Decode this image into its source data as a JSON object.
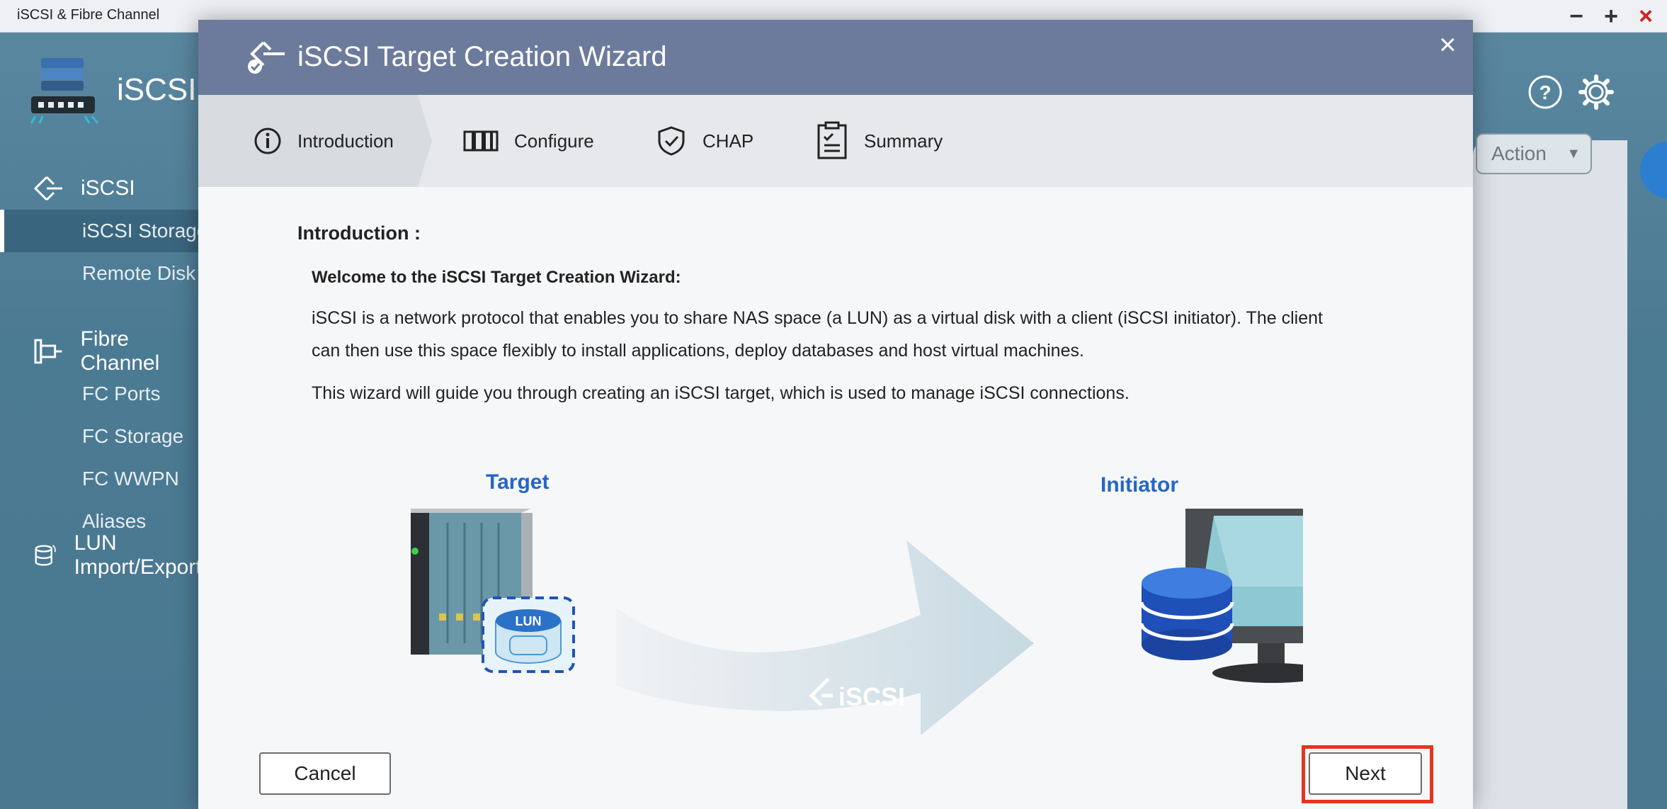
{
  "app": {
    "window_title": "iSCSI & Fibre Channel",
    "name": "iSCSI",
    "window_controls": {
      "minimize": "−",
      "maximize": "+",
      "close": "×"
    }
  },
  "sidebar": {
    "groups": [
      {
        "label": "iSCSI",
        "icon": "iscsi-diamond-icon",
        "items": [
          {
            "label": "iSCSI Storage",
            "active": true
          },
          {
            "label": "Remote Disk",
            "active": false
          }
        ]
      },
      {
        "label": "Fibre Channel",
        "icon": "fibre-channel-icon",
        "items": [
          {
            "label": "FC Ports",
            "active": false
          },
          {
            "label": "FC Storage",
            "active": false
          },
          {
            "label": "FC WWPN Aliases",
            "active": false
          }
        ]
      },
      {
        "label": "LUN Import/Export",
        "icon": "lun-import-icon",
        "items": []
      }
    ]
  },
  "header_icons": [
    "help-icon",
    "settings-gear-icon"
  ],
  "action_dropdown": {
    "label": "Action"
  },
  "modal": {
    "title": "iSCSI Target Creation Wizard",
    "close": "×",
    "steps": [
      {
        "label": "Introduction",
        "icon": "info-circle-icon",
        "active": true
      },
      {
        "label": "Configure",
        "icon": "configure-bars-icon",
        "active": false
      },
      {
        "label": "CHAP",
        "icon": "shield-check-icon",
        "active": false
      },
      {
        "label": "Summary",
        "icon": "clipboard-list-icon",
        "active": false
      }
    ],
    "intro_label": "Introduction :",
    "welcome": "Welcome to the iSCSI Target Creation Wizard:",
    "para1_line1": "iSCSI is a network protocol that enables you to share NAS space (a LUN) as a virtual disk with a client (iSCSI initiator). The client",
    "para1_line2": "can then use this space flexibly to install applications, deploy databases and host virtual machines.",
    "para2": "This wizard will guide you through creating an iSCSI target, which is used to manage iSCSI connections.",
    "diagram": {
      "target_label": "Target",
      "initiator_label": "Initiator",
      "lun_label": "LUN",
      "arrow_label": "iSCSI"
    },
    "buttons": {
      "cancel": "Cancel",
      "next": "Next"
    },
    "highlight_color": "#e8341c"
  }
}
